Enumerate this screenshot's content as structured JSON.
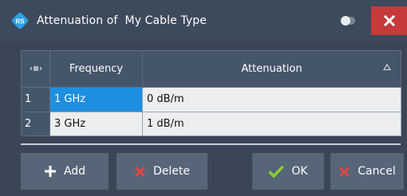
{
  "window": {
    "title": "Attenuation of  My Cable Type",
    "logo_icon": "rohde-schwarz-logo-icon",
    "toggle_icon": "toggle-switch-icon",
    "close_icon": "close-icon"
  },
  "table": {
    "columns": [
      {
        "label": "",
        "icon": "column-resize-icon"
      },
      {
        "label": "Frequency"
      },
      {
        "label": "Attenuation",
        "icon": "sort-ascending-icon"
      }
    ],
    "rows": [
      {
        "index": "1",
        "frequency": "1 GHz",
        "attenuation": "0 dB/m",
        "selected_column": "frequency"
      },
      {
        "index": "2",
        "frequency": "3 GHz",
        "attenuation": "1 dB/m"
      }
    ]
  },
  "buttons": {
    "add": {
      "label": "Add",
      "icon": "plus-icon"
    },
    "delete": {
      "label": "Delete",
      "icon": "delete-x-icon"
    },
    "ok": {
      "label": "OK",
      "icon": "checkmark-icon"
    },
    "cancel": {
      "label": "Cancel",
      "icon": "cancel-x-icon"
    }
  },
  "colors": {
    "dialog_background": "#3a4656",
    "header_background": "#46566a",
    "selected_cell": "#1e8fe0",
    "close_button": "#c73a3a",
    "button_background": "#566577",
    "delete_icon": "#e2463f",
    "ok_icon": "#8ccf2e",
    "cancel_icon": "#e2463f"
  }
}
